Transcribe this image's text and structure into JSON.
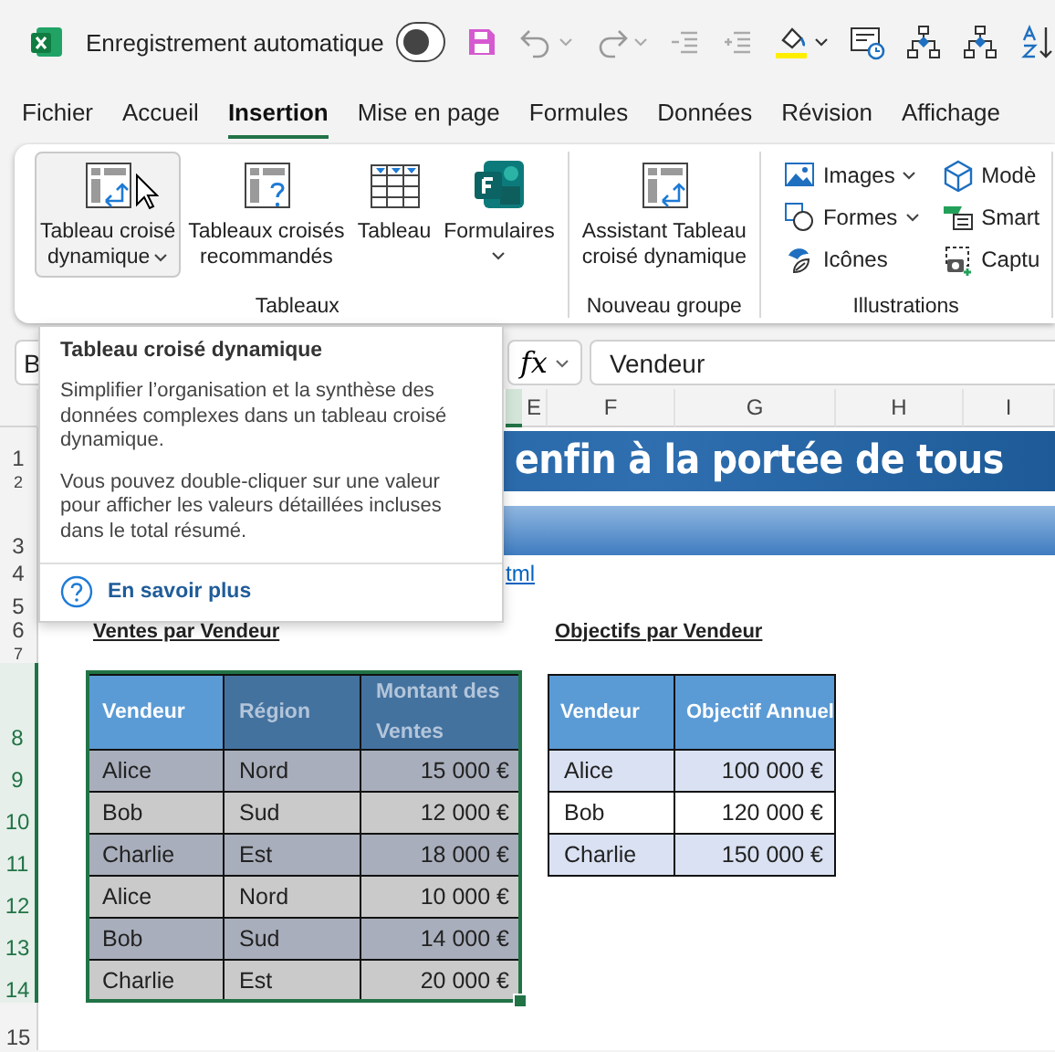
{
  "title_bar": {
    "autosave_label": "Enregistrement automatique",
    "autosave_on": false
  },
  "menu_tabs": [
    {
      "label": "Fichier",
      "selected": false
    },
    {
      "label": "Accueil",
      "selected": false
    },
    {
      "label": "Insertion",
      "selected": true
    },
    {
      "label": "Mise en page",
      "selected": false
    },
    {
      "label": "Formules",
      "selected": false
    },
    {
      "label": "Données",
      "selected": false
    },
    {
      "label": "Révision",
      "selected": false
    },
    {
      "label": "Affichage",
      "selected": false
    }
  ],
  "ribbon_groups": [
    {
      "name": "Tableaux",
      "buttons": [
        {
          "kind": "pivot",
          "label": "Tableau croisé\ndynamique",
          "dropdown": true,
          "hovered": true
        },
        {
          "kind": "recommended",
          "label": "Tableaux croisés\nrecommandés",
          "dropdown": false,
          "hovered": false
        },
        {
          "kind": "table",
          "label": "Tableau",
          "dropdown": false,
          "hovered": false
        },
        {
          "kind": "forms",
          "label": "Formulaires",
          "dropdown": true,
          "hovered": false
        }
      ]
    },
    {
      "name": "Nouveau groupe",
      "buttons": [
        {
          "kind": "pivot",
          "label": "Assistant Tableau\ncroisé dynamique",
          "dropdown": false,
          "hovered": false
        }
      ]
    },
    {
      "name": "Illustrations",
      "small_buttons": [
        {
          "kind": "images",
          "label": "Images",
          "dropdown": true
        },
        {
          "kind": "models",
          "label": "Modè",
          "dropdown": false
        },
        {
          "kind": "shapes",
          "label": "Formes",
          "dropdown": true
        },
        {
          "kind": "smartart",
          "label": "Smart",
          "dropdown": false
        },
        {
          "kind": "icons",
          "label": "Icônes",
          "dropdown": false
        },
        {
          "kind": "screenshot",
          "label": "Captu",
          "dropdown": false
        }
      ]
    }
  ],
  "formula_bar": {
    "name_box": "B",
    "fx": "fx",
    "value": "Vendeur"
  },
  "sheet": {
    "columns": [
      "E",
      "F",
      "G",
      "H",
      "I"
    ],
    "rows": [
      {
        "label": "1",
        "selected": false
      },
      {
        "label": "2",
        "selected": false
      },
      {
        "label": "3",
        "selected": false
      },
      {
        "label": "4",
        "selected": false
      },
      {
        "label": "5",
        "selected": false
      },
      {
        "label": "6",
        "selected": false
      },
      {
        "label": "7",
        "selected": false
      },
      {
        "label": "8",
        "selected": true
      },
      {
        "label": "9",
        "selected": true
      },
      {
        "label": "10",
        "selected": true
      },
      {
        "label": "11",
        "selected": true
      },
      {
        "label": "12",
        "selected": true
      },
      {
        "label": "13",
        "selected": true
      },
      {
        "label": "14",
        "selected": true
      },
      {
        "label": "15",
        "selected": false
      }
    ],
    "banner": "enfin à la portée de tous",
    "link": "tml",
    "sales_table": {
      "title": "Ventes par Vendeur",
      "selected": true,
      "columns": [
        "Vendeur",
        "Région",
        "Montant des Ventes"
      ],
      "rows": [
        [
          "Alice",
          "Nord",
          "15 000 €"
        ],
        [
          "Bob",
          "Sud",
          "12 000 €"
        ],
        [
          "Charlie",
          "Est",
          "18 000 €"
        ],
        [
          "Alice",
          "Nord",
          "10 000 €"
        ],
        [
          "Bob",
          "Sud",
          "14 000 €"
        ],
        [
          "Charlie",
          "Est",
          "20 000 €"
        ]
      ]
    },
    "targets_table": {
      "title": "Objectifs par Vendeur",
      "columns": [
        "Vendeur",
        "Objectif Annuel"
      ],
      "rows": [
        [
          "Alice",
          "100 000 €"
        ],
        [
          "Bob",
          "120 000 €"
        ],
        [
          "Charlie",
          "150 000 €"
        ]
      ]
    }
  },
  "tooltip": {
    "title": "Tableau croisé dynamique",
    "paragraphs": [
      "Simplifier l’organisation et la synthèse des données complexes dans un tableau croisé dynamique.",
      "Vous pouvez double-cliquer sur une valeur pour afficher les valeurs détaillées incluses dans le total résumé."
    ],
    "link": "En savoir plus"
  }
}
